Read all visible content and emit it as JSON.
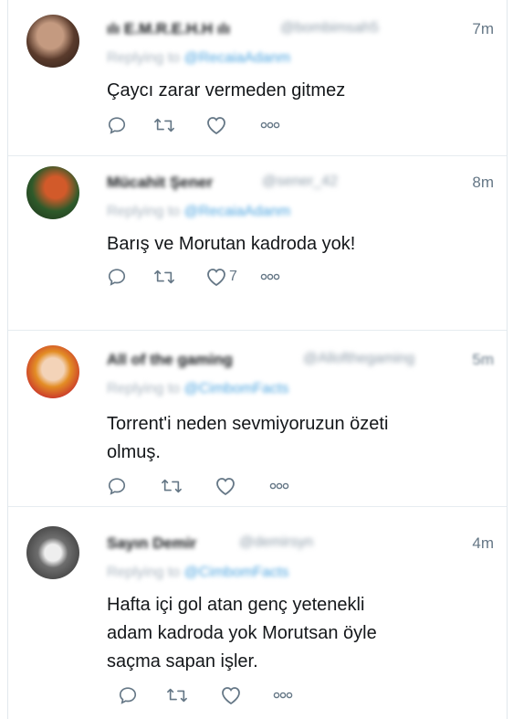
{
  "tweets": [
    {
      "name": "ılı E.M.R.E.H.H ılı",
      "handle": "@bombimsah5",
      "time": "7m",
      "replying_text": "Replying to",
      "replying_handle": "@RecaiaAdanm",
      "text": "Çaycı zarar vermeden gitmez",
      "like_count": ""
    },
    {
      "name": "Mücahit Şener",
      "handle": "@sener_42",
      "time": "8m",
      "replying_text": "Replying to",
      "replying_handle": "@RecaiaAdanm",
      "text": "Barış ve Morutan kadroda yok!",
      "like_count": "7"
    },
    {
      "name": "All of the gaming",
      "handle": "@Allofthegaming",
      "time": "5m",
      "replying_text": "Replying to",
      "replying_handle": "@CimbomFacts",
      "text": "Torrent'i neden sevmiyoruzun özeti\nolmuş.",
      "like_count": ""
    },
    {
      "name": "Sayın Demir",
      "handle": "@demirsyn",
      "time": "4m",
      "replying_text": "Replying to",
      "replying_handle": "@CimbomFacts",
      "text": "Hafta içi gol atan genç yetenekli\nadam kadroda yok Morutsan öyle\nsaçma sapan işler.",
      "like_count": ""
    }
  ],
  "icons": {
    "reply": "reply-icon",
    "retweet": "retweet-icon",
    "like": "heart-icon",
    "more": "more-icon"
  }
}
